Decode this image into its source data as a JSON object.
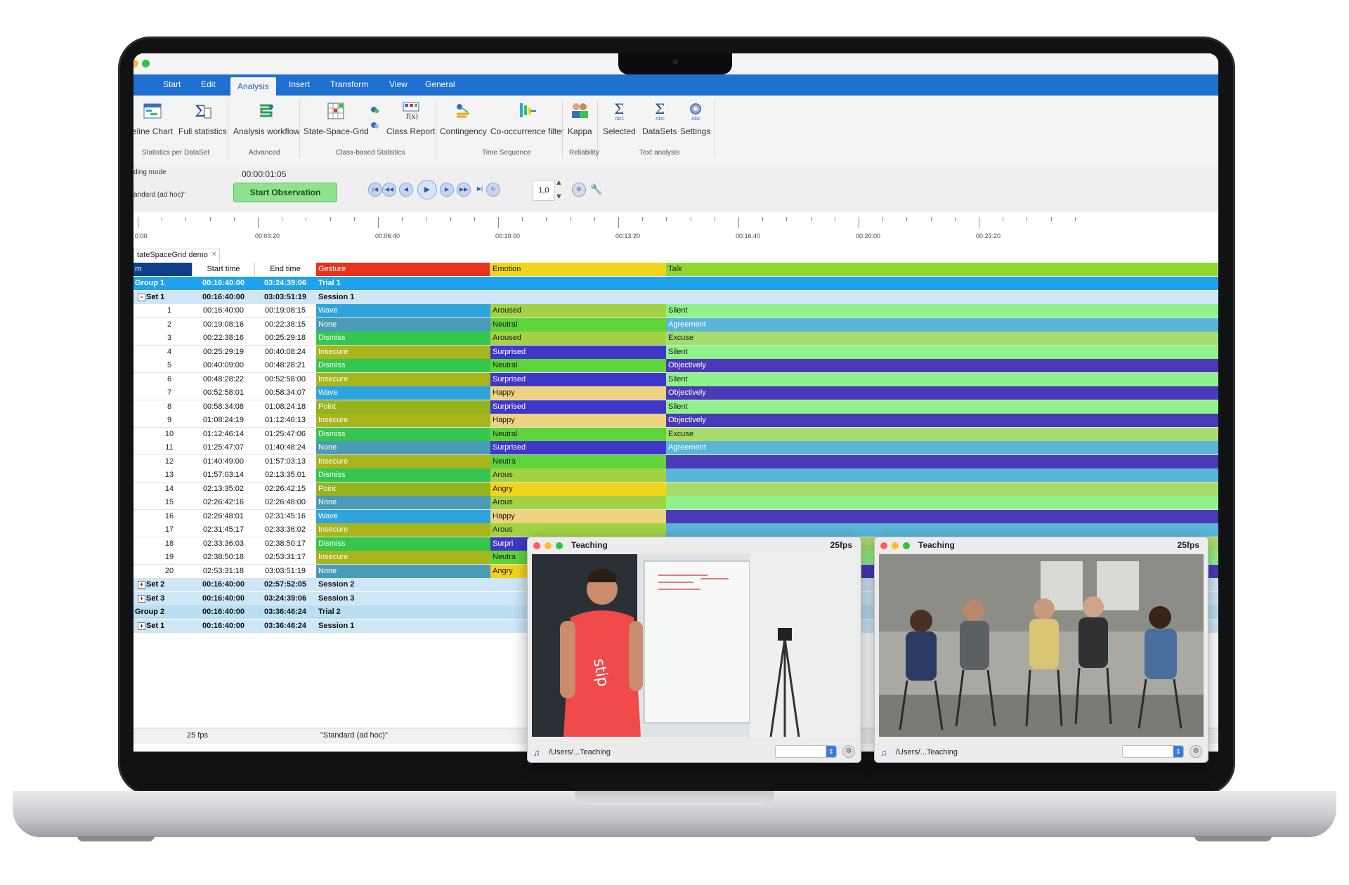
{
  "menu": {
    "tabs": [
      {
        "label": "Start"
      },
      {
        "label": "Edit"
      },
      {
        "label": "Analysis"
      },
      {
        "label": "Insert"
      },
      {
        "label": "Transform"
      },
      {
        "label": "View"
      },
      {
        "label": "General"
      }
    ],
    "active": "Analysis"
  },
  "ribbon": {
    "buttons": [
      {
        "label": "eline Chart"
      },
      {
        "label": "Full statistics"
      },
      {
        "label": "Analysis workflow"
      },
      {
        "label": "State-Space-Grid"
      },
      {
        "label": "Class Report"
      },
      {
        "label": "Contingency"
      },
      {
        "label": "Co-occurrence filter"
      },
      {
        "label": "Kappa"
      },
      {
        "label": "Selected"
      },
      {
        "label": "DataSets"
      },
      {
        "label": "Settings"
      }
    ],
    "groups": [
      {
        "label": "Statistics per DataSet"
      },
      {
        "label": "Advanced"
      },
      {
        "label": "Class-based Statistics"
      },
      {
        "label": "Time Sequence"
      },
      {
        "label": "Reliability"
      },
      {
        "label": "Text analysis"
      }
    ]
  },
  "toolbar": {
    "coding_mode_label": "ding mode",
    "coding_mode_value": "andard (ad hoc)\"",
    "time": "00:00:01:05",
    "start_observation": "Start Observation",
    "speed": "1,0"
  },
  "timeline": {
    "labels": [
      "0:00",
      "00:03:20",
      "00:06:40",
      "00:10:00",
      "00:13:20",
      "00:16:40",
      "00:20:00",
      "00:23:20"
    ]
  },
  "doc_tab": {
    "label": "tateSpaceGrid demo",
    "close": "×"
  },
  "grid": {
    "headers": {
      "index": "m",
      "start": "Start time",
      "end": "End time",
      "gesture": "Gesture",
      "emotion": "Emotion",
      "talk": "Talk"
    },
    "group1": {
      "label": "Group  1",
      "start": "00:16:40:00",
      "end": "03:24:39:06",
      "name": "Trial 1"
    },
    "set1": {
      "label": "Set  1",
      "start": "00:16:40:00",
      "end": "03:03:51:19",
      "name": "Session 1"
    },
    "rows": [
      {
        "n": "1",
        "start": "00:16:40:00",
        "end": "00:19:08:15",
        "gesture": "Wave",
        "emotion": "Aroused",
        "talk": "Silent"
      },
      {
        "n": "2",
        "start": "00:19:08:16",
        "end": "00:22:38:15",
        "gesture": "None",
        "emotion": "Neutral",
        "talk": "Agreement"
      },
      {
        "n": "3",
        "start": "00:22:38:16",
        "end": "00:25:29:18",
        "gesture": "Dismiss",
        "emotion": "Aroused",
        "talk": "Excuse"
      },
      {
        "n": "4",
        "start": "00:25:29:19",
        "end": "00:40:08:24",
        "gesture": "Insecure",
        "emotion": "Surprised",
        "talk": "Silent"
      },
      {
        "n": "5",
        "start": "00:40:09:00",
        "end": "00:48:28:21",
        "gesture": "Dismiss",
        "emotion": "Neutral",
        "talk": "Objectively"
      },
      {
        "n": "6",
        "start": "00:48:28:22",
        "end": "00:52:58:00",
        "gesture": "Insecure",
        "emotion": "Surprised",
        "talk": "Silent"
      },
      {
        "n": "7",
        "start": "00:52:58:01",
        "end": "00:58:34:07",
        "gesture": "Wave",
        "emotion": "Happy",
        "talk": "Objectively"
      },
      {
        "n": "8",
        "start": "00:58:34:08",
        "end": "01:08:24:18",
        "gesture": "Point",
        "emotion": "Surprised",
        "talk": "Silent"
      },
      {
        "n": "9",
        "start": "01:08:24:19",
        "end": "01:12:46:13",
        "gesture": "Insecure",
        "emotion": "Happy",
        "talk": "Objectively"
      },
      {
        "n": "10",
        "start": "01:12:46:14",
        "end": "01:25:47:06",
        "gesture": "Dismiss",
        "emotion": "Neutral",
        "talk": "Excuse"
      },
      {
        "n": "11",
        "start": "01:25:47:07",
        "end": "01:40:48:24",
        "gesture": "None",
        "emotion": "Surprised",
        "talk": "Agreement"
      },
      {
        "n": "12",
        "start": "01:40:49:00",
        "end": "01:57:03:13",
        "gesture": "Insecure",
        "emotion": "Neutra",
        "talk": ""
      },
      {
        "n": "13",
        "start": "01:57:03:14",
        "end": "02:13:35:01",
        "gesture": "Dismiss",
        "emotion": "Arous",
        "talk": ""
      },
      {
        "n": "14",
        "start": "02:13:35:02",
        "end": "02:26:42:15",
        "gesture": "Point",
        "emotion": "Angry",
        "talk": ""
      },
      {
        "n": "15",
        "start": "02:26:42:16",
        "end": "02:26:48:00",
        "gesture": "None",
        "emotion": "Arous",
        "talk": ""
      },
      {
        "n": "16",
        "start": "02:26:48:01",
        "end": "02:31:45:16",
        "gesture": "Wave",
        "emotion": "Happy",
        "talk": ""
      },
      {
        "n": "17",
        "start": "02:31:45:17",
        "end": "02:33:36:02",
        "gesture": "Insecure",
        "emotion": "Arous",
        "talk": ""
      },
      {
        "n": "18",
        "start": "02:33:36:03",
        "end": "02:38:50:17",
        "gesture": "Dismiss",
        "emotion": "Surpri",
        "talk": ""
      },
      {
        "n": "19",
        "start": "02:38:50:18",
        "end": "02:53:31:17",
        "gesture": "Insecure",
        "emotion": "Neutra",
        "talk": ""
      },
      {
        "n": "20",
        "start": "02:53:31:18",
        "end": "03:03:51:19",
        "gesture": "None",
        "emotion": "Angry",
        "talk": ""
      }
    ],
    "tail": [
      {
        "label": "Set  2",
        "start": "00:16:40:00",
        "end": "02:57:52:05",
        "name": "Session 2"
      },
      {
        "label": "Set  3",
        "start": "00:16:40:00",
        "end": "03:24:39:06",
        "name": "Session 3"
      },
      {
        "label": "Group  2",
        "start": "00:16:40:00",
        "end": "03:36:46:24",
        "name": "Trial 2"
      },
      {
        "label": "Set  1",
        "start": "00:16:40:00",
        "end": "03:36:46:24",
        "name": "Session 1"
      }
    ]
  },
  "colors": {
    "gesture_header": "#e8321e",
    "emotion_header": "#f1d51c",
    "talk_header": "#8fd92e",
    "Wave": "#2fa4dc",
    "None": "#4a9bb5",
    "Dismiss": "#35c64f",
    "Insecure": "#a8b51c",
    "Point": "#94b31c",
    "Aroused": "#a3d345",
    "Arous": "#a3d345",
    "Neutral": "#5fd43a",
    "Neutra": "#5fd43a",
    "Surprised": "#3f37c9",
    "Surpri": "#3f37c9",
    "Happy": "#ecd37f",
    "Angry": "#f1d51c",
    "Silent": "#90f28a",
    "Agreement": "#5ab5d8",
    "Excuse": "#a6dc6c",
    "Objectively": "#4b3ab5"
  },
  "status": {
    "fps": "25 fps",
    "mode": "\"Standard (ad hoc)\""
  },
  "videos": [
    {
      "title": "Teaching",
      "fps": "25fps",
      "path": "/Users/...Teaching"
    },
    {
      "title": "Teaching",
      "fps": "25fps",
      "path": "/Users/...Teaching"
    }
  ]
}
